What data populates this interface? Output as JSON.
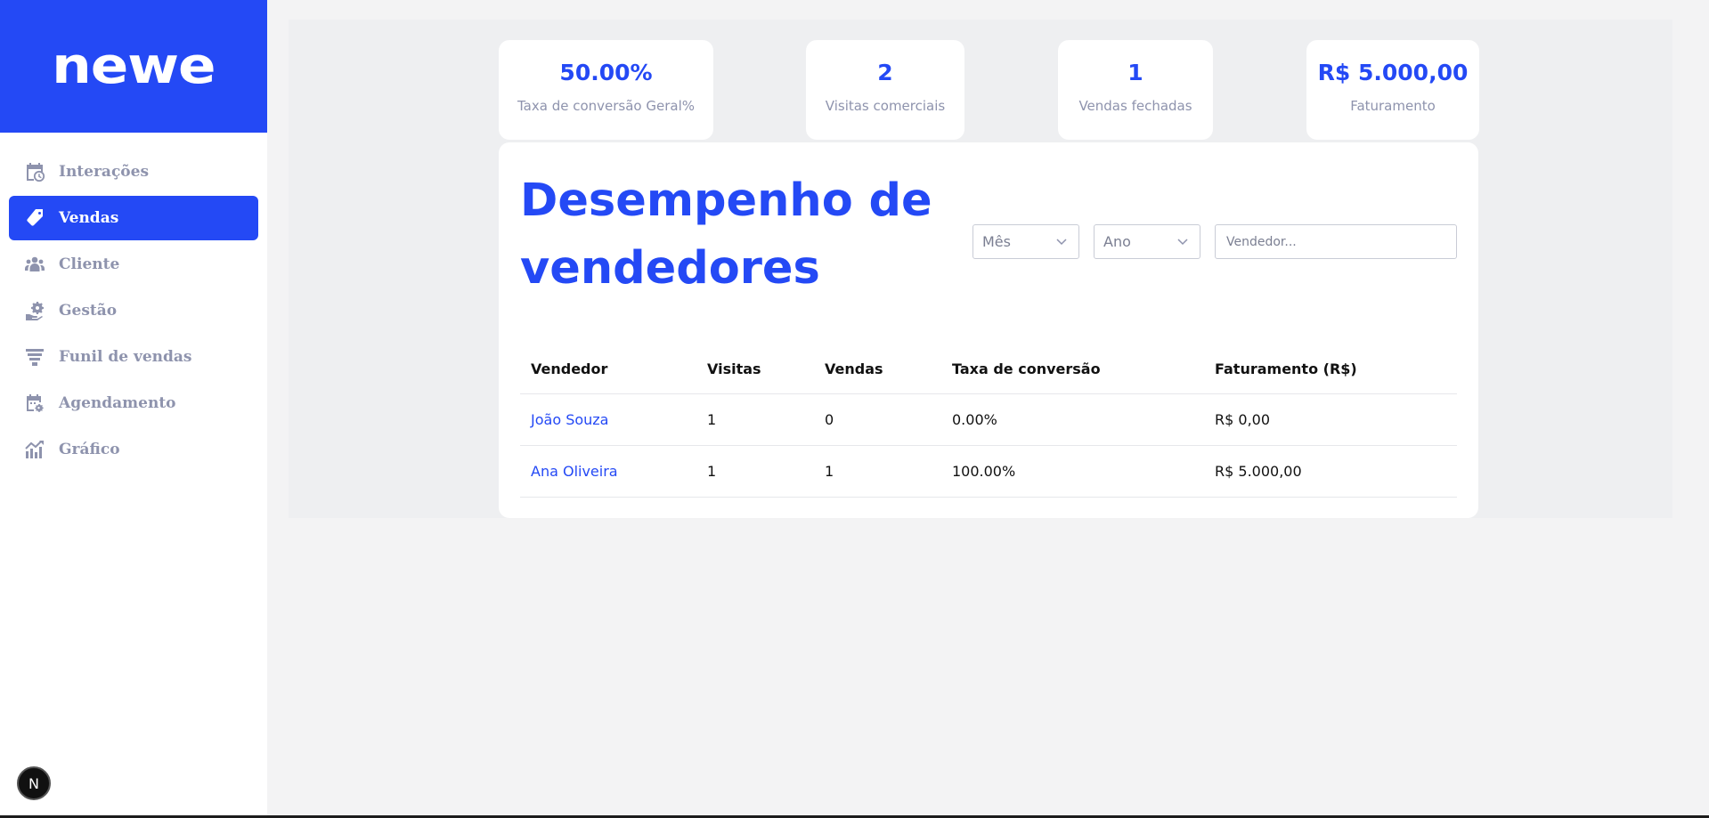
{
  "brand": {
    "logo": "newe",
    "accent": "#2449f5"
  },
  "sidebar": {
    "items": [
      {
        "label": "Interações",
        "icon": "calendar-clock-icon",
        "active": false
      },
      {
        "label": "Vendas",
        "icon": "tag-icon",
        "active": true
      },
      {
        "label": "Cliente",
        "icon": "users-icon",
        "active": false
      },
      {
        "label": "Gestão",
        "icon": "hand-gear-icon",
        "active": false
      },
      {
        "label": "Funil de vendas",
        "icon": "funnel-icon",
        "active": false
      },
      {
        "label": "Agendamento",
        "icon": "calendar-gear-icon",
        "active": false
      },
      {
        "label": "Gráfico",
        "icon": "chart-line-icon",
        "active": false
      }
    ]
  },
  "badge": {
    "letter": "N"
  },
  "stats": [
    {
      "value": "50.00%",
      "label": "Taxa de conversão Geral%"
    },
    {
      "value": "2",
      "label": "Visitas comerciais"
    },
    {
      "value": "1",
      "label": "Vendas fechadas"
    },
    {
      "value": "R$ 5.000,00",
      "label": "Faturamento"
    }
  ],
  "performance": {
    "title": "Desempenho de vendedores",
    "filters": {
      "month_value": "Mês",
      "year_value": "Ano",
      "search_placeholder": "Vendedor..."
    },
    "columns": [
      "Vendedor",
      "Visitas",
      "Vendas",
      "Taxa de conversão",
      "Faturamento (R$)"
    ],
    "rows": [
      {
        "name": "João Souza",
        "visits": "1",
        "sales": "0",
        "rate": "0.00%",
        "revenue": "R$ 0,00"
      },
      {
        "name": "Ana Oliveira",
        "visits": "1",
        "sales": "1",
        "rate": "100.00%",
        "revenue": "R$ 5.000,00"
      }
    ]
  }
}
